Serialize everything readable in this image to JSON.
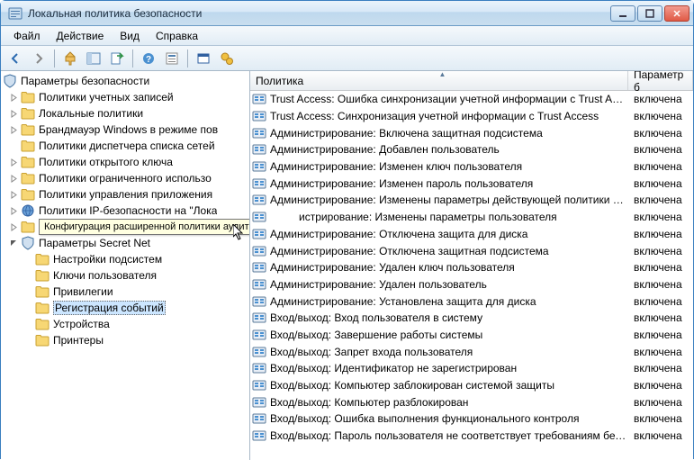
{
  "window": {
    "title": "Локальная политика безопасности"
  },
  "menu": {
    "file": "Файл",
    "action": "Действие",
    "view": "Вид",
    "help": "Справка"
  },
  "tree": {
    "root": "Параметры безопасности",
    "items": [
      {
        "label": "Политики учетных записей",
        "icon": "folder",
        "expandable": true
      },
      {
        "label": "Локальные политики",
        "icon": "folder",
        "expandable": true
      },
      {
        "label": "Брандмауэр Windows в режиме пов",
        "icon": "folder",
        "expandable": true
      },
      {
        "label": "Политики диспетчера списка сетей",
        "icon": "folder",
        "expandable": false
      },
      {
        "label": "Политики открытого ключа",
        "icon": "folder",
        "expandable": true
      },
      {
        "label": "Политики ограниченного использо",
        "icon": "folder",
        "expandable": true
      },
      {
        "label": "Политики управления приложения",
        "icon": "folder",
        "expandable": true
      },
      {
        "label": "Политики IP-безопасности на \"Лока",
        "icon": "globe",
        "expandable": true
      },
      {
        "label": "Конфигурация расширенной полити",
        "icon": "folder",
        "expandable": true
      },
      {
        "label": "Параметры Secret Net",
        "icon": "shield",
        "expandable": true,
        "expanded": true,
        "children": [
          {
            "label": "Настройки подсистем",
            "icon": "folder"
          },
          {
            "label": "Ключи пользователя",
            "icon": "folder"
          },
          {
            "label": "Привилегии",
            "icon": "folder"
          },
          {
            "label": "Регистрация событий",
            "icon": "folder",
            "selected": true
          },
          {
            "label": "Устройства",
            "icon": "folder"
          },
          {
            "label": "Принтеры",
            "icon": "folder"
          }
        ]
      }
    ]
  },
  "tooltip": "Конфигурация расширенной политики аудита",
  "list": {
    "columns": {
      "policy": "Политика",
      "setting": "Параметр б"
    },
    "rows": [
      {
        "name": "Trust Access: Ошибка синхронизации учетной информации с Trust Access",
        "value": "включена"
      },
      {
        "name": "Trust Access: Синхронизация учетной информации с Trust Access",
        "value": "включена"
      },
      {
        "name": "Администрирование: Включена защитная подсистема",
        "value": "включена"
      },
      {
        "name": "Администрирование: Добавлен пользователь",
        "value": "включена"
      },
      {
        "name": "Администрирование: Изменен ключ пользователя",
        "value": "включена"
      },
      {
        "name": "Администрирование: Изменен пароль пользователя",
        "value": "включена"
      },
      {
        "name": "Администрирование: Изменены параметры действующей политики безоп...",
        "value": "включена"
      },
      {
        "name": "истрирование: Изменены параметры пользователя",
        "value": "включена"
      },
      {
        "name": "Администрирование: Отключена защита для диска",
        "value": "включена"
      },
      {
        "name": "Администрирование: Отключена защитная подсистема",
        "value": "включена"
      },
      {
        "name": "Администрирование: Удален ключ пользователя",
        "value": "включена"
      },
      {
        "name": "Администрирование: Удален пользователь",
        "value": "включена"
      },
      {
        "name": "Администрирование: Установлена защита для диска",
        "value": "включена"
      },
      {
        "name": "Вход/выход: Вход пользователя в систему",
        "value": "включена"
      },
      {
        "name": "Вход/выход: Завершение работы системы",
        "value": "включена"
      },
      {
        "name": "Вход/выход: Запрет входа пользователя",
        "value": "включена"
      },
      {
        "name": "Вход/выход: Идентификатор не зарегистрирован",
        "value": "включена"
      },
      {
        "name": "Вход/выход: Компьютер заблокирован системой защиты",
        "value": "включена"
      },
      {
        "name": "Вход/выход: Компьютер разблокирован",
        "value": "включена"
      },
      {
        "name": "Вход/выход: Ошибка выполнения функционального контроля",
        "value": "включена"
      },
      {
        "name": "Вход/выход: Пароль пользователя не соответствует требованиям безопасн",
        "value": "включена"
      }
    ]
  }
}
